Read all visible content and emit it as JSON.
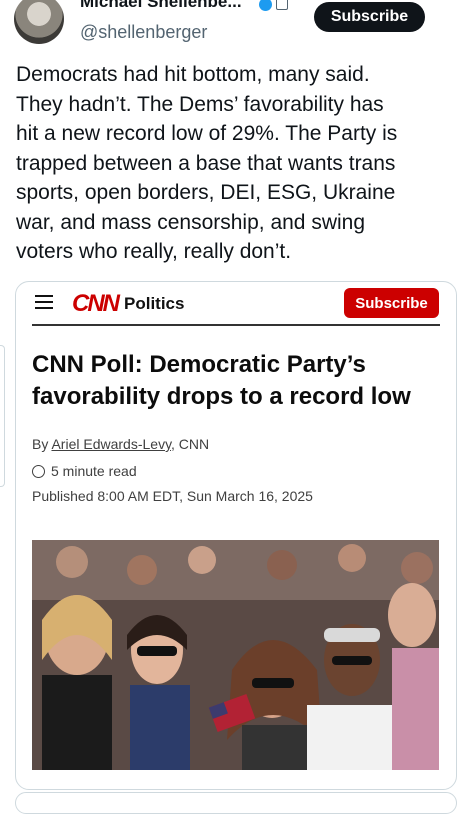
{
  "post": {
    "display_name": "Michael Shellenbe...",
    "handle": "@shellenberger",
    "subscribe_label": "Subscribe",
    "text": "Democrats had hit bottom, many said.\nThey hadn’t. The Dems’ favorability has\nhit a new record low of 29%. The Party is\ntrapped between a base that wants trans\nsports, open borders, DEI, ESG, Ukraine\nwar, and mass censorship, and swing\nvoters who really, really don’t."
  },
  "article": {
    "logo_text": "CNN",
    "section": "Politics",
    "subscribe_label": "Subscribe",
    "headline": "CNN Poll: Democratic Party’s favorability drops to a record low",
    "byline_prefix": "By ",
    "author": "Ariel Edwards-Levy",
    "byline_suffix": ", CNN",
    "read_time": "5 minute read",
    "published": "Published 8:00 AM EDT, Sun March 16, 2025"
  },
  "icons": {
    "menu": "hamburger-icon",
    "clock": "clock-icon",
    "verified": "verified-badge-icon"
  },
  "colors": {
    "cnn_red": "#cc0000",
    "x_black": "#0f1419",
    "verified_blue": "#1d9bf0"
  }
}
